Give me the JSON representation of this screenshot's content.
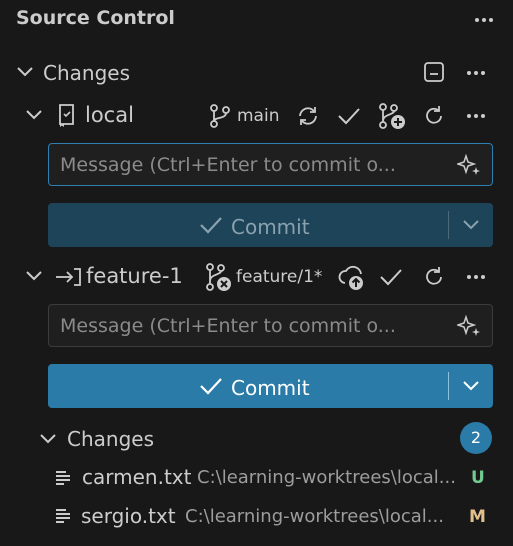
{
  "panel": {
    "title": "Source Control"
  },
  "changes_section": {
    "label": "Changes"
  },
  "repos": [
    {
      "name": "local",
      "branch": "main",
      "message_placeholder": "Message (Ctrl+Enter to commit o...",
      "commit_label": "Commit",
      "commit_state": "disabled"
    },
    {
      "name": "feature-1",
      "branch": "feature/1*",
      "message_placeholder": "Message (Ctrl+Enter to commit o...",
      "commit_label": "Commit",
      "commit_state": "enabled",
      "changes": {
        "label": "Changes",
        "count": "2",
        "files": [
          {
            "name": "carmen.txt",
            "path": "C:\\learning-worktrees\\local...",
            "status": "U"
          },
          {
            "name": "sergio.txt",
            "path": "C:\\learning-worktrees\\local...",
            "status": "M"
          }
        ]
      }
    }
  ],
  "colors": {
    "background": "#181818",
    "accent": "#2b7ba8",
    "untracked": "#73c991",
    "modified": "#e2c08d"
  }
}
